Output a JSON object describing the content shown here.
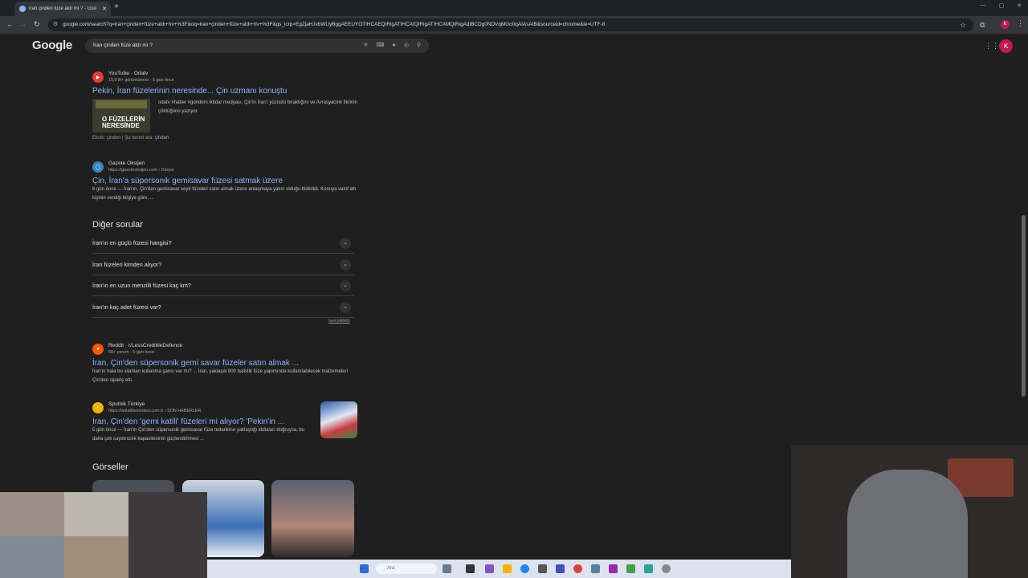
{
  "browser": {
    "tab_title": "İran çinden füze aldı mı ? - Goo",
    "tab_close": "✕",
    "new_tab": "+",
    "url": "google.com/search?q=iran+çinden+füze+aldı+mı+%3F&oq=iran+çinden+füze+aldı+mı+%3F&gs_lcrp=EgZjaHJvbWUyBggAEEUYOTIHCAEQIRigATIHCAIQIRigATIHCAMQIRigAdIBCDg0NDVqMGo0qAIAsAIB&sourceid=chrome&ie=UTF-8",
    "profile_letter": "K",
    "window_controls": [
      "—",
      "▢",
      "✕"
    ]
  },
  "google": {
    "logo": "Google",
    "query": "İran çinden füze aldı mı ?",
    "avatar_letter": "K"
  },
  "results": [
    {
      "source": "YouTube · Odatv",
      "meta": "15,8 B+ görüntüleme · 5 gün önce",
      "title": "Pekin, İran füzelerinin neresinde... Çin uzmanı konuştu",
      "snippet": "odatv #haber #gündem iktidar medyası, Çin'in İran'ı yüzüstü bıraktığını ve Avrasyacılık fikrinin çöktüğünü yazıyor.",
      "thumb_text": "O FÜZELERİN NERESİNDE",
      "tagline_prefix": "Eksik: çinden | Şu terimi ara:",
      "tagline_link": "çinden"
    },
    {
      "source": "Gazete Oksijen",
      "meta": "https://gazeteoksijen.com › Dünya",
      "title": "Çin, İran'a süpersonik gemisavar füzesi satmak üzere",
      "snippet": "6 gün önce — İran'ın, Çin'den gemisavar seyir füzeleri satın almak üzere anlaşmaya yakın olduğu bildirildi. Konuya vakıf altı kişinin verdiği bilgiye göre, ..."
    },
    {
      "source": "Reddit · r/LessCredibleDefence",
      "meta": "60+ yorum · 6 gün önce",
      "title": "İran, Çin'den süpersonik gemi savar füzeler satın almak ...",
      "snippet": "İran'ın hala bu silahları kullanma şansı var mı? ... İran, yaklaşık 800 balistik füze yapımında kullanılabilecek malzemeleri Çin'den sipariş etti."
    },
    {
      "source": "Sputnik Türkiye",
      "meta": "https://anlatilaninotesi.com.tr › SON HABERLER",
      "title": "İran, Çin'den 'gemi katili' füzeleri mi alıyor? 'Pekin'in ...",
      "snippet": "5 gün önce — İran'ın Çin'den süpersonik gemisavar füze tedarikine yaklaştığı iddiaları doğruysa, bu daha çok caydırıcılık kapasitesinin güçlendirilmesi ..."
    }
  ],
  "other_questions": {
    "title": "Diğer sorular",
    "items": [
      "İran'ın en güçlü füzesi hangisi?",
      "İran füzeleri kimden alıyor?",
      "İran'ın en uzun menzilli füzesi kaç km?",
      "İran'ın kaç adet füzesi var?"
    ],
    "feedback": "Geri bildirim"
  },
  "images_title": "Görseller",
  "taskbar": {
    "search_placeholder": "Ara"
  },
  "colors": {
    "link": "#8ab4f8",
    "background": "#1f1f1f",
    "accent_profile": "#c2185b"
  }
}
